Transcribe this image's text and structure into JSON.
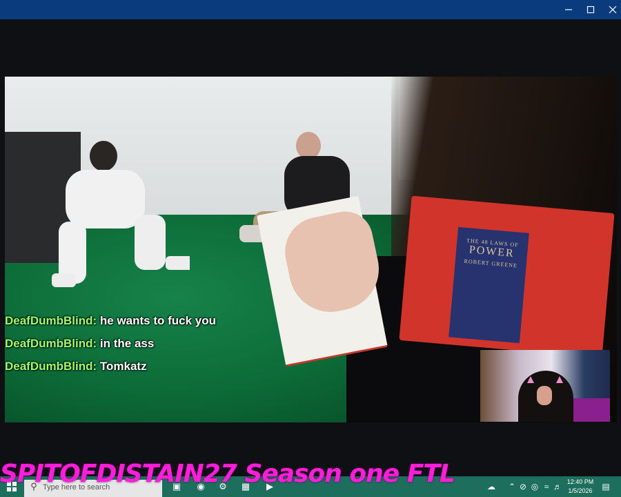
{
  "window": {
    "controls": {
      "minimize": "minimize",
      "maximize": "maximize",
      "close": "close"
    }
  },
  "video": {
    "book_cover": {
      "line1": "THE 48 LAWS OF",
      "line2": "POWER",
      "line3": "ROBERT GREENE"
    }
  },
  "chat": {
    "messages": [
      {
        "user": "DeafDumbBlind:",
        "text": " he wants to fuck you"
      },
      {
        "user": "DeafDumbBlind:",
        "text": " in the ass"
      },
      {
        "user": "DeafDumbBlind:",
        "text": " Tomkatz"
      }
    ],
    "username_color": "#9dff6b"
  },
  "overlay": {
    "title": "SPITOFDISTAIN27 Season one FTL",
    "title_color": "#ff1fd8"
  },
  "taskbar": {
    "search_placeholder": "Type here to search",
    "clock_time": "12:40 PM",
    "clock_date": "1/5/2026",
    "color": "#1e6e5e"
  },
  "colors": {
    "titlebar": "#0a3b7c"
  }
}
